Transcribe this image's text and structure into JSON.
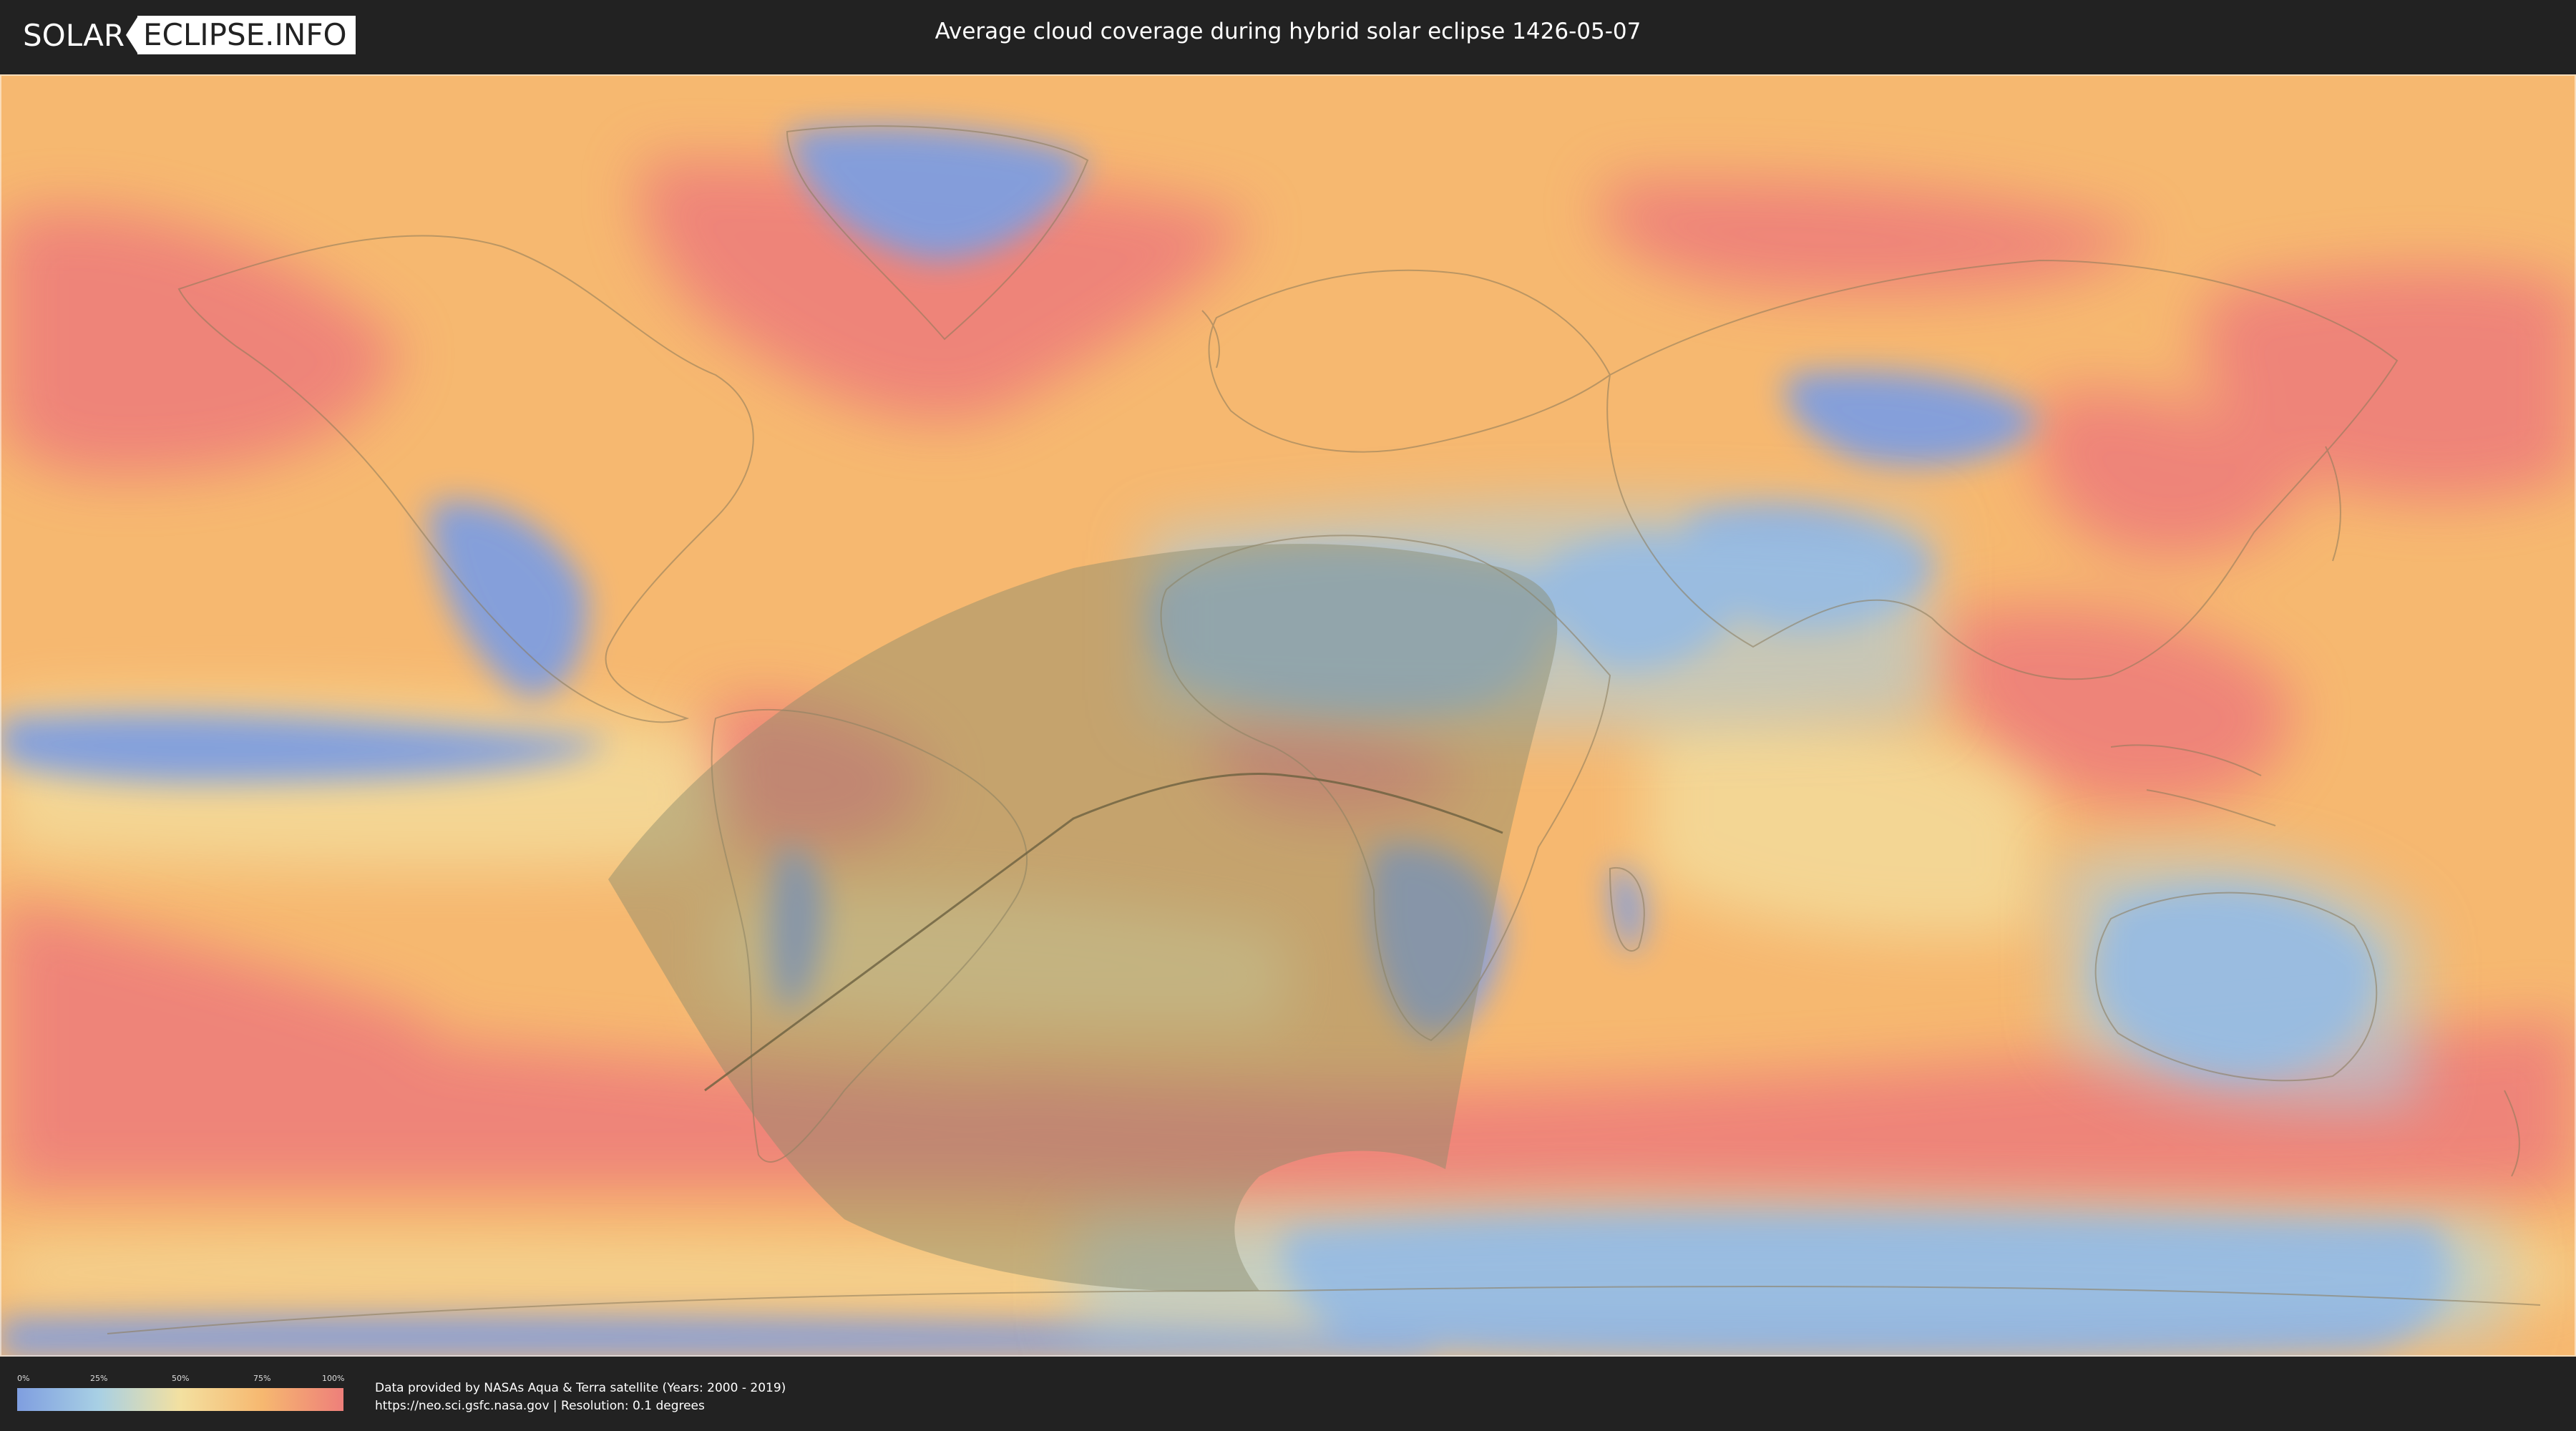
{
  "header": {
    "logo_left": "SOLAR",
    "logo_right": "ECLIPSE.INFO",
    "title": "Average cloud coverage during hybrid solar eclipse 1426-05-07"
  },
  "legend": {
    "ticks": [
      "0%",
      "25%",
      "50%",
      "75%",
      "100%"
    ],
    "colors": [
      "#7f9ee0",
      "#a8d0e4",
      "#f3e0a0",
      "#f6b870",
      "#ee7f7a"
    ]
  },
  "credits": {
    "line1": "Data provided by NASAs Aqua & Terra satellite (Years: 2000 - 2019)",
    "line2": "https://neo.sci.gsfc.nasa.gov | Resolution: 0.1 degrees"
  },
  "map": {
    "projection": "equirectangular",
    "eclipse_type": "hybrid",
    "colors": {
      "ocean_base": "#f6b870",
      "high_cloud": "#ee7f7a",
      "low_cloud": "#7f9ee0",
      "mid_cloud": "#f3e0a0",
      "eclipse_shadow": "#8a8a6a",
      "central_line": "#6b6040",
      "coastline": "#8a7a5a"
    }
  }
}
